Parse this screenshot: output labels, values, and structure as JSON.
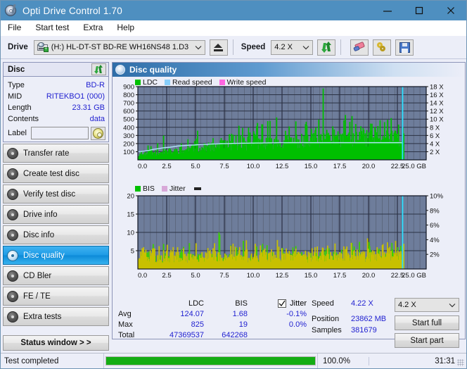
{
  "window": {
    "title": "Opti Drive Control 1.70",
    "app_icon": "disc-pen-icon",
    "minimize": "minimize-icon",
    "maximize": "maximize-icon",
    "close": "close-icon",
    "titlebar_color": "#4e8fc0"
  },
  "menu": [
    "File",
    "Start test",
    "Extra",
    "Help"
  ],
  "toolbar": {
    "drive_label": "Drive",
    "drive_value": "(H:)  HL-DT-ST BD-RE  WH16NS48 1.D3",
    "eject_title": "Eject",
    "speed_label": "Speed",
    "speed_value": "4.2 X",
    "refresh_title": "Refresh",
    "erase_title": "Erase",
    "key_title": "Keys",
    "save_title": "Save"
  },
  "disc": {
    "header": "Disc",
    "refresh_icon": "refresh-icon",
    "rows": [
      {
        "key": "Type",
        "value": "BD-R"
      },
      {
        "key": "MID",
        "value": "RITEKBO1 (000)"
      },
      {
        "key": "Length",
        "value": "23.31 GB"
      },
      {
        "key": "Contents",
        "value": "data"
      }
    ],
    "label_key": "Label",
    "label_value": "",
    "label_placeholder": ""
  },
  "nav": [
    {
      "label": "Transfer rate",
      "active": false
    },
    {
      "label": "Create test disc",
      "active": false
    },
    {
      "label": "Verify test disc",
      "active": false
    },
    {
      "label": "Drive info",
      "active": false
    },
    {
      "label": "Disc info",
      "active": false
    },
    {
      "label": "Disc quality",
      "active": true
    },
    {
      "label": "CD Bler",
      "active": false
    },
    {
      "label": "FE / TE",
      "active": false
    },
    {
      "label": "Extra tests",
      "active": false
    }
  ],
  "status_window_button": "Status window > >",
  "panel": {
    "title": "Disc quality",
    "icon": "disc-quality-icon"
  },
  "stats": {
    "col_headers": [
      "",
      "LDC",
      "BIS",
      "Jitter"
    ],
    "jitter_checked": true,
    "rows": [
      {
        "label": "Avg",
        "ldc": "124.07",
        "bis": "1.68",
        "jitter": "-0.1%"
      },
      {
        "label": "Max",
        "ldc": "825",
        "bis": "19",
        "jitter": "0.0%"
      },
      {
        "label": "Total",
        "ldc": "47369537",
        "bis": "642268",
        "jitter": ""
      }
    ],
    "speed_key": "Speed",
    "speed_value": "4.22 X",
    "position_key": "Position",
    "position_value": "23862 MB",
    "samples_key": "Samples",
    "samples_value": "381679",
    "speed_select": "4.2 X",
    "start_full": "Start full",
    "start_part": "Start part"
  },
  "statusbar": {
    "text": "Test completed",
    "percent": "100.0%",
    "progress": 100,
    "time": "31:31",
    "progress_color": "#14ad14"
  },
  "chart_data": [
    {
      "type": "area",
      "title": "Disc quality - LDC",
      "xlabel": "GB",
      "ylabel": "LDC",
      "xlim": [
        0,
        25
      ],
      "ylim": [
        0,
        900
      ],
      "xticks": [
        "0.0",
        "2.5",
        "5.0",
        "7.5",
        "10.0",
        "12.5",
        "15.0",
        "17.5",
        "20.0",
        "22.5",
        "25.0 GB"
      ],
      "yticks": [
        "100",
        "200",
        "300",
        "400",
        "500",
        "600",
        "700",
        "800",
        "900"
      ],
      "y2lim": [
        0,
        18
      ],
      "y2ticks": [
        "2 X",
        "4 X",
        "6 X",
        "8 X",
        "10 X",
        "12 X",
        "14 X",
        "16 X",
        "18 X"
      ],
      "grid": true,
      "legend_position": "top-left",
      "legend": [
        {
          "name": "LDC",
          "color": "#00c000"
        },
        {
          "name": "Read speed",
          "color": "#87cefa"
        },
        {
          "name": "Write speed",
          "color": "#ff66e0"
        }
      ],
      "plot_bg": "#6e7d9b",
      "series": [
        {
          "name": "LDC",
          "color": "#00c000",
          "kind": "spikes",
          "x_end": 23.0,
          "baseline": [
            60,
            75,
            85,
            82,
            90,
            95,
            88,
            92,
            100,
            105,
            98,
            110,
            115,
            108,
            120,
            125,
            130,
            128,
            135,
            140,
            145,
            150,
            155,
            150,
            160,
            165,
            170,
            168,
            175,
            180,
            185,
            190,
            188,
            195,
            200,
            198,
            205,
            210,
            208,
            215,
            212,
            218,
            222,
            220,
            225,
            228,
            230,
            226,
            232,
            235,
            238,
            234,
            240,
            242,
            245,
            240,
            244,
            248,
            250,
            246,
            252,
            255,
            250,
            256,
            258,
            254,
            260,
            262,
            258,
            264,
            266,
            262,
            268,
            270,
            266,
            272,
            274,
            270,
            276,
            278,
            274,
            280,
            282,
            278,
            284,
            286,
            282,
            288,
            290,
            286,
            292,
            294,
            290,
            296,
            298,
            294,
            300,
            302,
            298,
            305
          ],
          "spikes": [
            400,
            550,
            300,
            180,
            250,
            420,
            160,
            300,
            210,
            520,
            140,
            380,
            200,
            480,
            160,
            170,
            230,
            360,
            250,
            140,
            190,
            300,
            410,
            180,
            250,
            340,
            220,
            160,
            200,
            560,
            180,
            240,
            410,
            150,
            280,
            230,
            190,
            330,
            260,
            170,
            300,
            220,
            470,
            160,
            350,
            250,
            190,
            420,
            300,
            180,
            280,
            640,
            200,
            330,
            270,
            180,
            250,
            700,
            210,
            320,
            260,
            180,
            310,
            590,
            230,
            400,
            280,
            190,
            350,
            825,
            220,
            330,
            470,
            200,
            300,
            660,
            250,
            390,
            300,
            200,
            340,
            560,
            230,
            420,
            310,
            210,
            370,
            610,
            260,
            400,
            300,
            500,
            240,
            430,
            330,
            220,
            390,
            560,
            280,
            410
          ]
        },
        {
          "name": "Read speed",
          "color": "#aee8f8",
          "kind": "line",
          "x_end": 23.0,
          "values_x_speed": [
            2.0,
            2.05,
            2.1,
            2.2,
            2.3,
            2.45,
            2.6,
            2.7,
            2.8,
            2.9,
            3.0,
            3.05,
            3.1,
            3.2,
            3.3,
            3.4,
            3.45,
            3.5,
            3.55,
            3.6,
            3.62,
            3.65,
            3.7,
            3.75,
            3.78,
            3.8,
            3.85,
            3.88,
            3.9,
            3.92,
            3.95,
            3.98,
            4.0,
            4.0,
            4.02,
            4.03,
            4.05,
            4.06,
            4.08,
            4.09,
            4.1,
            4.1,
            4.12,
            4.13,
            4.14,
            4.15,
            4.15,
            4.16,
            4.17,
            4.18,
            4.18,
            4.19,
            4.2,
            4.2,
            4.2,
            4.21,
            4.21,
            4.22,
            4.22,
            4.22,
            4.22,
            4.22,
            4.22,
            4.22,
            4.22,
            4.22,
            4.22,
            4.22,
            4.22,
            4.22,
            4.22,
            4.22,
            4.22,
            4.22,
            4.22,
            4.22,
            4.22,
            4.22,
            4.22,
            4.22,
            4.22,
            4.22,
            4.22,
            4.22,
            4.22,
            4.22,
            4.22,
            4.22,
            4.22,
            4.22,
            4.22,
            4.22,
            4.22,
            4.22,
            4.22,
            4.22,
            4.22,
            4.22,
            4.22,
            4.22
          ]
        },
        {
          "name": "end-marker",
          "color": "#30d8f8",
          "kind": "vline",
          "x": 22.95
        }
      ]
    },
    {
      "type": "area",
      "title": "Disc quality - BIS / Jitter",
      "xlabel": "GB",
      "ylabel": "BIS",
      "xlim": [
        0,
        25
      ],
      "ylim": [
        0,
        20
      ],
      "xticks": [
        "0.0",
        "2.5",
        "5.0",
        "7.5",
        "10.0",
        "12.5",
        "15.0",
        "17.5",
        "20.0",
        "22.5",
        "25.0 GB"
      ],
      "yticks": [
        "5",
        "10",
        "15",
        "20"
      ],
      "y2lim": [
        0,
        10
      ],
      "y2ticks": [
        "2%",
        "4%",
        "6%",
        "8%",
        "10%"
      ],
      "grid": true,
      "legend_position": "top-left",
      "legend": [
        {
          "name": "BIS",
          "color": "#00c000"
        },
        {
          "name": "Jitter",
          "color": "#d8a8d8"
        }
      ],
      "plot_bg": "#6e7d9b",
      "series": [
        {
          "name": "BIS",
          "color": "#3ad000",
          "kind": "spikes",
          "x_end": 23.0,
          "baseline": [
            2.0,
            3.2,
            2.4,
            4.0,
            2.6,
            3.0,
            2.2,
            3.6,
            2.8,
            2.4,
            3.4,
            2.6,
            3.0,
            2.2,
            3.8,
            2.4,
            3.2,
            2.8,
            2.6,
            3.4,
            2.2,
            3.0,
            2.8,
            3.6,
            2.4,
            3.2,
            2.6,
            3.8,
            2.8,
            2.4,
            3.4,
            2.6,
            3.0,
            2.2,
            3.6,
            2.8,
            3.2,
            2.4,
            3.0,
            2.6,
            3.8,
            2.4,
            3.4,
            2.8,
            3.0,
            2.6,
            3.6,
            2.2,
            3.2,
            2.8,
            3.0,
            2.4,
            3.8,
            2.6,
            3.4,
            2.8,
            3.0,
            2.2,
            3.6,
            2.4,
            3.2,
            2.8,
            3.0,
            2.6,
            3.8,
            2.4,
            3.4,
            2.8,
            3.2,
            2.6,
            3.0,
            2.8,
            3.6,
            2.4,
            3.2,
            2.8,
            3.4,
            2.6,
            3.0,
            2.8,
            3.8,
            2.6,
            3.4,
            2.8,
            3.2,
            2.4,
            3.6,
            2.8,
            3.0,
            2.6,
            3.4,
            2.8,
            3.2,
            2.6,
            3.8,
            2.8,
            3.4,
            3.0,
            3.6,
            3.2
          ],
          "spikes": [
            8.0,
            11.0,
            5.5,
            7.0,
            4.5,
            10.0,
            5.0,
            6.5,
            4.0,
            7.5,
            5.0,
            4.5,
            6.0,
            5.5,
            4.0,
            6.5,
            5.0,
            8.0,
            4.5,
            7.0,
            5.5,
            6.0,
            4.0,
            8.0,
            5.0,
            6.5,
            4.5,
            7.0,
            5.5,
            4.0,
            10.0,
            6.0,
            9.0,
            5.0,
            7.0,
            4.5,
            6.5,
            5.5,
            4.0,
            7.5,
            5.0,
            6.0,
            4.5,
            8.0,
            5.5,
            7.0,
            4.0,
            6.5,
            5.0,
            7.5,
            4.5,
            6.0,
            5.5,
            8.5,
            5.0,
            6.5,
            4.5,
            7.0,
            5.5,
            6.0,
            4.0,
            8.0,
            5.0,
            7.5,
            4.5,
            6.5,
            5.5,
            7.0,
            5.0,
            6.0,
            4.5,
            8.0,
            5.5,
            6.5,
            5.0,
            7.0,
            4.5,
            6.0,
            5.5,
            8.5,
            5.0,
            6.5,
            4.5,
            7.5,
            5.5,
            6.0,
            5.0,
            7.0,
            4.5,
            6.5,
            5.5,
            8.0,
            5.0,
            6.5,
            5.5,
            7.0,
            5.0,
            6.0,
            5.5,
            6.5
          ]
        },
        {
          "name": "Jitter",
          "color": "#c8c000",
          "kind": "spikes",
          "x_end": 23.0,
          "baseline": [
            2.5,
            3.0,
            2.8,
            3.2,
            2.6,
            3.4,
            2.8,
            3.0,
            3.2,
            2.8,
            3.4,
            3.0,
            2.8,
            3.2,
            3.6,
            3.0,
            3.4,
            3.2,
            2.8,
            3.6,
            3.0,
            3.4,
            3.2,
            3.8,
            3.0,
            3.6,
            3.2,
            4.0,
            3.4,
            3.0,
            3.8,
            3.4,
            3.6,
            3.0,
            4.0,
            3.4,
            3.8,
            3.2,
            3.6,
            3.4,
            4.2,
            3.2,
            3.8,
            3.6,
            3.4,
            3.2,
            4.0,
            3.0,
            3.8,
            3.4,
            3.6,
            3.2,
            4.2,
            3.4,
            3.8,
            3.6,
            3.4,
            3.0,
            4.0,
            3.2,
            3.8,
            3.6,
            3.4,
            3.2,
            4.2,
            3.0,
            3.8,
            3.6,
            3.8,
            3.4,
            3.6,
            3.4,
            4.0,
            3.2,
            3.8,
            3.6,
            4.0,
            3.4,
            3.8,
            3.6,
            4.2,
            3.4,
            4.0,
            3.6,
            3.8,
            3.2,
            4.2,
            3.6,
            3.8,
            3.4,
            4.0,
            3.6,
            3.8,
            3.4,
            4.2,
            3.6,
            4.0,
            3.8,
            4.2,
            4.0
          ],
          "spikes": [
            4.5,
            5.5,
            4.0,
            5.0,
            4.5,
            6.0,
            4.0,
            5.5,
            4.5,
            5.0,
            6.5,
            4.5,
            5.5,
            5.0,
            4.5,
            6.0,
            5.0,
            5.5,
            4.5,
            6.5,
            5.0,
            5.5,
            4.5,
            6.0,
            5.0,
            6.5,
            5.5,
            5.0,
            6.0,
            4.5,
            7.0,
            5.5,
            6.0,
            5.0,
            6.5,
            5.0,
            6.0,
            5.5,
            5.0,
            6.5,
            5.5,
            6.0,
            5.0,
            7.0,
            5.5,
            6.5,
            5.0,
            6.0,
            5.5,
            7.0,
            5.0,
            6.5,
            6.0,
            7.5,
            5.5,
            6.5,
            5.0,
            7.0,
            6.0,
            6.5,
            5.0,
            7.5,
            5.5,
            7.0,
            5.5,
            6.5,
            6.0,
            7.0,
            5.5,
            6.5,
            5.0,
            7.5,
            6.0,
            7.0,
            5.5,
            7.0,
            5.0,
            6.5,
            6.0,
            8.0,
            5.5,
            7.0,
            5.0,
            7.5,
            6.0,
            6.5,
            5.5,
            7.5,
            5.0,
            7.0,
            6.0,
            8.0,
            5.5,
            7.0,
            6.0,
            7.5,
            5.5,
            6.5,
            6.0,
            7.0
          ]
        },
        {
          "name": "end-marker",
          "color": "#30d8f8",
          "kind": "vline",
          "x": 22.95
        }
      ]
    }
  ]
}
